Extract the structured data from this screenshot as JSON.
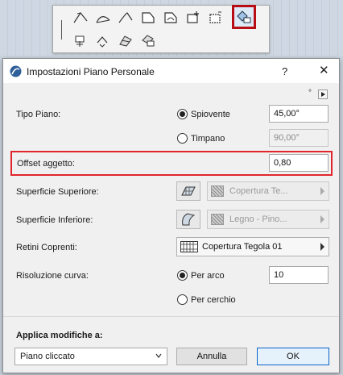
{
  "dialog": {
    "title": "Impostazioni Piano Personale",
    "help": "?",
    "close": "✕"
  },
  "form": {
    "tipo_piano": {
      "label": "Tipo Piano:",
      "options": [
        {
          "label": "Spiovente",
          "value": "45,00°",
          "checked": true,
          "enabled": true
        },
        {
          "label": "Timpano",
          "value": "90,00°",
          "checked": false,
          "enabled": false
        }
      ]
    },
    "offset": {
      "label": "Offset aggetto:",
      "value": "0,80"
    },
    "superficie_superiore": {
      "label": "Superficie Superiore:",
      "material": "Copertura Te..."
    },
    "superficie_inferiore": {
      "label": "Superficie Inferiore:",
      "material": "Legno - Pino..."
    },
    "retini_coprenti": {
      "label": "Retini Coprenti:",
      "value": "Copertura Tegola 01"
    },
    "risoluzione_curva": {
      "label": "Risoluzione curva:",
      "options": [
        {
          "label": "Per arco",
          "checked": true
        },
        {
          "label": "Per cerchio",
          "checked": false
        }
      ],
      "value": "10"
    }
  },
  "footer": {
    "apply_label": "Applica modifiche a:",
    "apply_value": "Piano cliccato",
    "cancel_label": "Annulla",
    "ok_label": "OK"
  },
  "page_nav": {
    "marker": "°"
  },
  "colors": {
    "highlight": "#e0262c",
    "default_button_border": "#0a64c8"
  }
}
